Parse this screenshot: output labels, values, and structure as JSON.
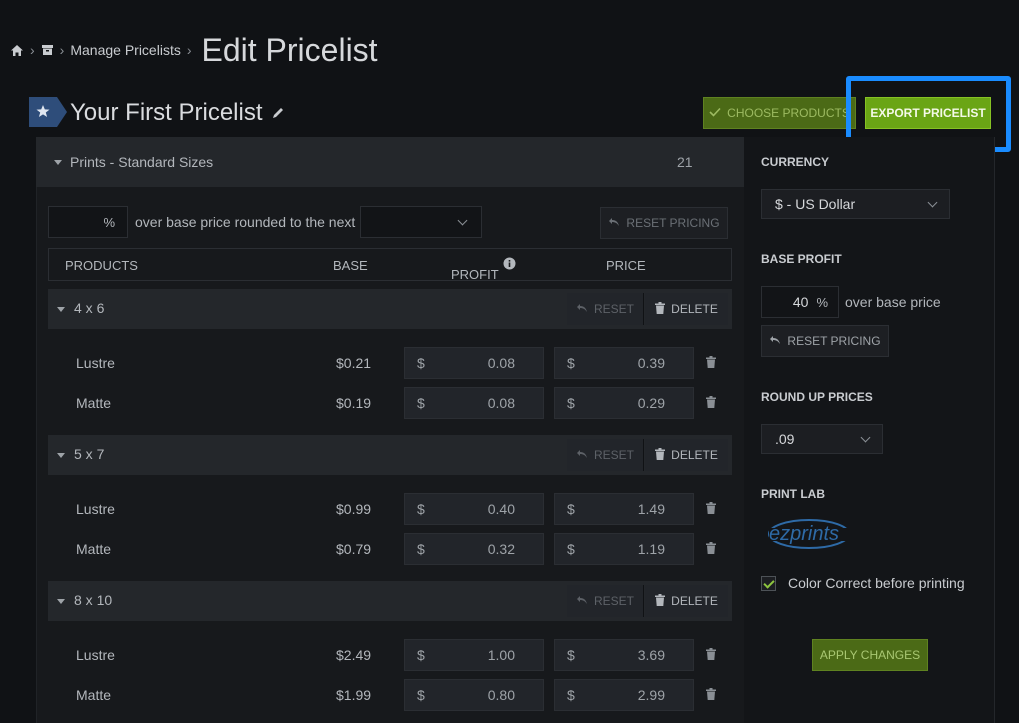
{
  "breadcrumb": {
    "manage": "Manage Pricelists",
    "current": "Edit Pricelist"
  },
  "pricelist": {
    "name": "Your First Pricelist"
  },
  "toolbar": {
    "choose_label": "CHOOSE PRODUCTS",
    "export_label": "EXPORT PRICELIST"
  },
  "category": {
    "name": "Prints - Standard Sizes",
    "count": "21"
  },
  "markup": {
    "percent_value": "",
    "percent_symbol": "%",
    "over_text": "over base price rounded to the next",
    "round_value": "",
    "reset_label": "RESET PRICING"
  },
  "columns": {
    "products": "PRODUCTS",
    "base": "BASE",
    "profit": "PROFIT",
    "price": "PRICE"
  },
  "row_actions": {
    "reset": "RESET",
    "delete": "DELETE"
  },
  "currency_symbol": "$",
  "sizes": [
    {
      "label": "4 x 6",
      "products": [
        {
          "name": "Lustre",
          "base": "$0.21",
          "profit": "0.08",
          "price": "0.39"
        },
        {
          "name": "Matte",
          "base": "$0.19",
          "profit": "0.08",
          "price": "0.29"
        }
      ]
    },
    {
      "label": "5 x 7",
      "products": [
        {
          "name": "Lustre",
          "base": "$0.99",
          "profit": "0.40",
          "price": "1.49"
        },
        {
          "name": "Matte",
          "base": "$0.79",
          "profit": "0.32",
          "price": "1.19"
        }
      ]
    },
    {
      "label": "8 x 10",
      "products": [
        {
          "name": "Lustre",
          "base": "$2.49",
          "profit": "1.00",
          "price": "3.69"
        },
        {
          "name": "Matte",
          "base": "$1.99",
          "profit": "0.80",
          "price": "2.99"
        }
      ]
    }
  ],
  "sidebar": {
    "currency_label": "CURRENCY",
    "currency_value": "$ - US Dollar",
    "base_profit_label": "BASE PROFIT",
    "base_profit_value": "40",
    "base_profit_symbol": "%",
    "base_profit_text": "over base price",
    "reset_label": "RESET PRICING",
    "round_up_label": "ROUND UP PRICES",
    "round_up_value": ".09",
    "print_lab_label": "PRINT LAB",
    "lab_logo_text": "ezprints",
    "color_correct_label": "Color Correct before printing",
    "color_correct_checked": true,
    "apply_label": "APPLY CHANGES"
  },
  "colors": {
    "accent_green": "#6aa515",
    "highlight_blue": "#1a8cff"
  }
}
